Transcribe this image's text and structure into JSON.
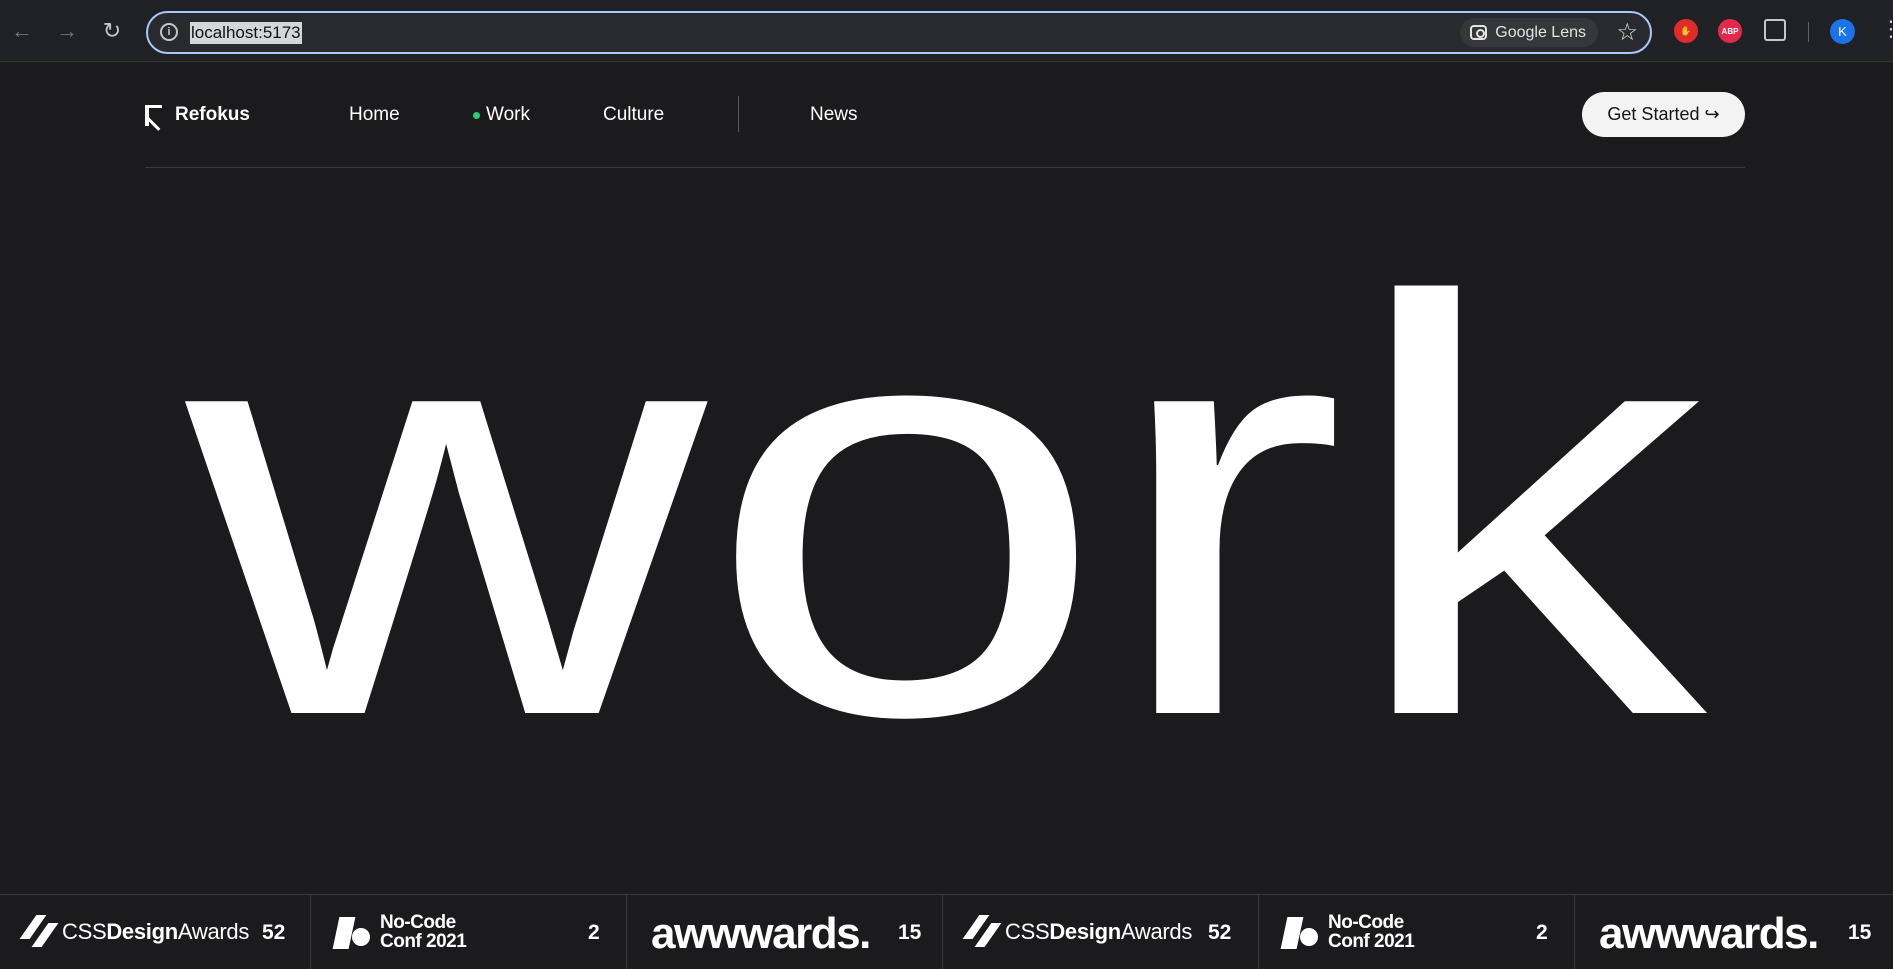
{
  "browser": {
    "url": "localhost:5173",
    "lens_label": "Google Lens",
    "ext_abp_label": "ABP",
    "avatar_initial": "K",
    "icons": [
      "back-icon",
      "forward-icon",
      "reload-icon",
      "site-info-icon",
      "google-lens-icon",
      "star-icon",
      "extension-stop-icon",
      "adblock-plus-icon",
      "extensions-puzzle-icon",
      "profile-avatar",
      "menu-kebab-icon"
    ]
  },
  "nav": {
    "brand": "Refokus",
    "links": [
      "Home",
      "Work",
      "Culture",
      "News"
    ],
    "active": "Work",
    "active_color": "#2ecc71",
    "cta_label": "Get Started ↪"
  },
  "hero": {
    "word": "work"
  },
  "awards": [
    {
      "name_light": "CSS",
      "name_bold": "Design",
      "name_tail": "Awards",
      "count": "52"
    },
    {
      "line1": "No-Code",
      "line2": "Conf 2021",
      "count": "2"
    },
    {
      "name": "awwwards.",
      "count": "15"
    },
    {
      "name_light": "CSS",
      "name_bold": "Design",
      "name_tail": "Awards",
      "count": "52"
    },
    {
      "line1": "No-Code",
      "line2": "Conf 2021",
      "count": "2"
    },
    {
      "name": "awwwards.",
      "count": "15"
    }
  ],
  "colors": {
    "page_bg": "#1b1b1d",
    "text": "#ffffff",
    "cta_bg": "#f3f3f3"
  }
}
